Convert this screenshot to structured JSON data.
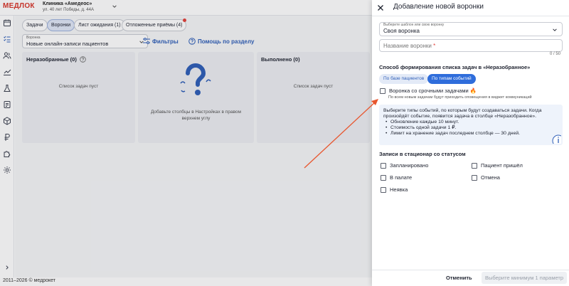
{
  "app": {
    "logo": "МЕДЛОК",
    "clinic_name": "Клиника «Амедеос»",
    "clinic_address": "ул. 40 лет Победы, д. 44А"
  },
  "tabs": [
    {
      "label": "Задачи"
    },
    {
      "label": "Воронки"
    },
    {
      "label": "Лист ожидания (1)"
    },
    {
      "label": "Отложенные приёмы (4)"
    }
  ],
  "funnel_select": {
    "label": "Воронка",
    "value": "Новые онлайн-записи пациентов"
  },
  "toolbar": {
    "filters": "Фильтры",
    "help": "Помощь по разделу"
  },
  "columns": {
    "unsorted": {
      "title": "Неразобранные (0)",
      "empty": "Список задач пуст"
    },
    "placeholder": {
      "text": "Добавьте столбцы в Настройках в правом верхнем углу"
    },
    "done": {
      "title": "Выполнено (0)",
      "empty": "Список задач пуст"
    }
  },
  "footer": {
    "text": "2011–2026 © медрокет"
  },
  "drawer": {
    "title": "Добавление новой воронки",
    "template": {
      "label": "Выберите шаблон или свою воронку",
      "value": "Своя воронка"
    },
    "name": {
      "placeholder": "Название воронки",
      "counter": "0 / 50"
    },
    "method_title": "Способ формирования списка задач в «Неразобранное»",
    "method_options": [
      "По базе пациентов",
      "По типам событий"
    ],
    "method_selected": "По типам событий",
    "urgent": {
      "label": "Воронка со срочными задачами",
      "checked": false,
      "hint": "По всем новым задачам будут приходить оповещения в виджет коммуникаций"
    },
    "info": {
      "text": "Выберите типы событий, по которым будут создаваться задачи. Когда произойдёт событие, появится задача в столбце «Неразобранное».",
      "items": [
        "Обновление каждые 10 минут.",
        "Стоимость одной задачи 1 ₽.",
        "Лимит на хранение задач последнем столбце — 30 дней."
      ]
    },
    "status_title": "Записи в стационар со статусом",
    "statuses": [
      {
        "label": "Запланировано",
        "checked": false
      },
      {
        "label": "Пациент пришёл",
        "checked": false
      },
      {
        "label": "В палате",
        "checked": false
      },
      {
        "label": "Отмена",
        "checked": false
      },
      {
        "label": "Неявка",
        "checked": false
      }
    ],
    "cancel": "Отменить",
    "submit": "Выберите минимум 1 параметр"
  },
  "colors": {
    "accent": "#2f6ddb",
    "logo": "#d9362b",
    "annotation_arrow": "#e8562e",
    "badge": "#e3413a"
  }
}
